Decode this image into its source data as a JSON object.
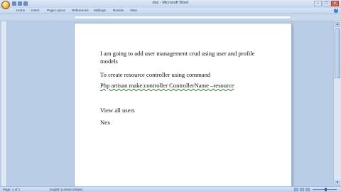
{
  "window": {
    "title": "doc - Microsoft Word"
  },
  "ribbon": {
    "tabs": [
      "Home",
      "Insert",
      "Page Layout",
      "References",
      "Mailings",
      "Review",
      "View"
    ]
  },
  "document": {
    "paragraphs": [
      "I am going to add user management crud using user and profile models",
      "To create resource controller using command",
      "Php artisan make:controller ControllerName –resource",
      "View all users",
      "Nex"
    ]
  },
  "statusbar": {
    "page": "Page: 1 of 1",
    "language": "English (United States)"
  },
  "colors": {
    "ribbon": "#c6d8ef",
    "background": "#b9cde6"
  }
}
